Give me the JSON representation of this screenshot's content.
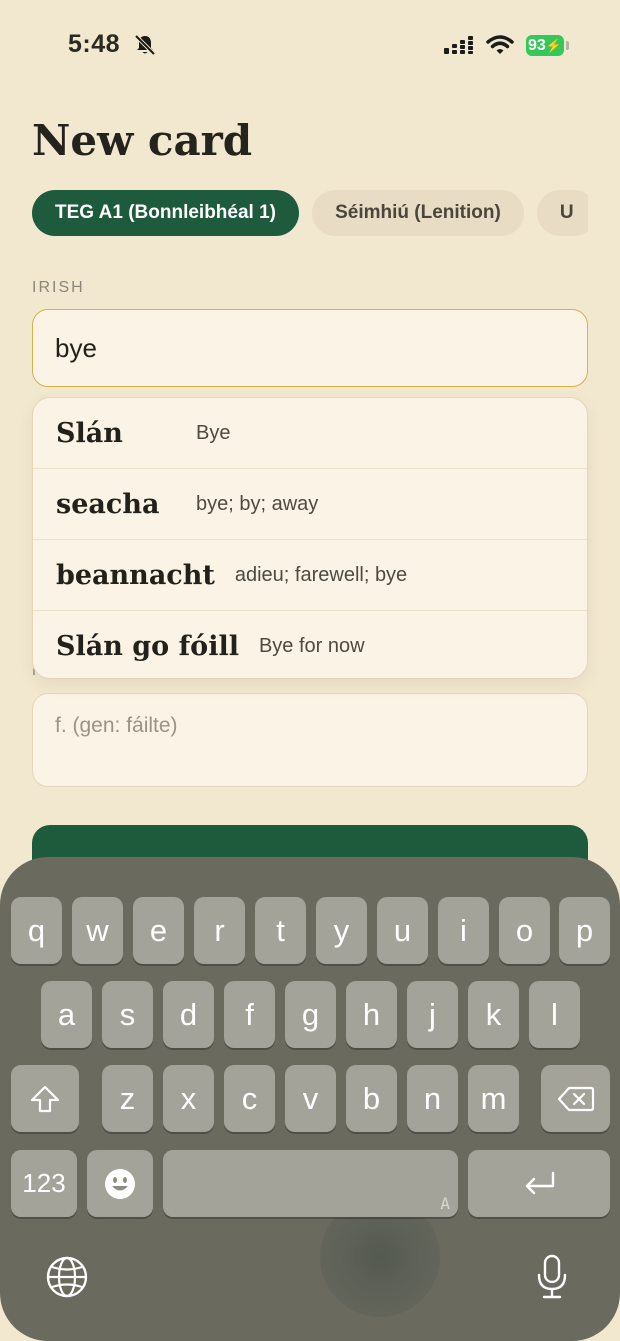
{
  "status": {
    "time": "5:48",
    "battery": "93"
  },
  "page": {
    "title": "New card"
  },
  "chips": [
    {
      "label": "TEG A1 (Bonnleibhéal 1)",
      "active": true
    },
    {
      "label": "Séimhiú (Lenition)",
      "active": false
    },
    {
      "label": "U",
      "active": false
    }
  ],
  "irish": {
    "label": "IRISH",
    "value": "bye"
  },
  "suggestions": [
    {
      "word": "Slán",
      "translation": "Bye"
    },
    {
      "word": "seacha",
      "translation": "bye; by; away"
    },
    {
      "word": "beannacht",
      "translation": "adieu; farewell; bye"
    },
    {
      "word": "Slán go fóill",
      "translation": "Bye for now"
    }
  ],
  "notes": {
    "label": "N",
    "placeholder": "f. (gen: fáilte)"
  },
  "keyboard": {
    "row1": [
      "q",
      "w",
      "e",
      "r",
      "t",
      "y",
      "u",
      "i",
      "o",
      "p"
    ],
    "row2": [
      "a",
      "s",
      "d",
      "f",
      "g",
      "h",
      "j",
      "k",
      "l"
    ],
    "row3": [
      "z",
      "x",
      "c",
      "v",
      "b",
      "n",
      "m"
    ],
    "numbers_label": "123",
    "space_hint": "A"
  },
  "colors": {
    "accent": "#1e5a3c",
    "background": "#f2e8d0",
    "input_focus": "#d4b24c"
  }
}
